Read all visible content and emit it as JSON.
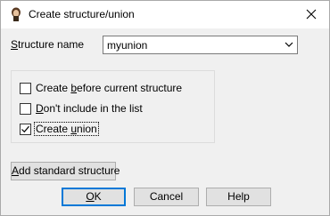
{
  "window": {
    "title": "Create structure/union",
    "app_icon": "ida-app-icon",
    "close_icon": "close-icon"
  },
  "form": {
    "structure_name_label_u": "S",
    "structure_name_label_rest": "tructure name",
    "structure_name_value": "myunion",
    "options": [
      {
        "pre": "Create ",
        "u": "b",
        "post": "efore current structure",
        "checked": false
      },
      {
        "pre": "",
        "u": "D",
        "post": "on't include in the list",
        "checked": false
      },
      {
        "pre": "Create ",
        "u": "u",
        "post": "nion",
        "checked": true
      }
    ]
  },
  "buttons": {
    "add_standard_pre": "",
    "add_standard_u": "A",
    "add_standard_post": "dd standard structure",
    "ok_u": "O",
    "ok_post": "K",
    "cancel": "Cancel",
    "help": "Help"
  }
}
